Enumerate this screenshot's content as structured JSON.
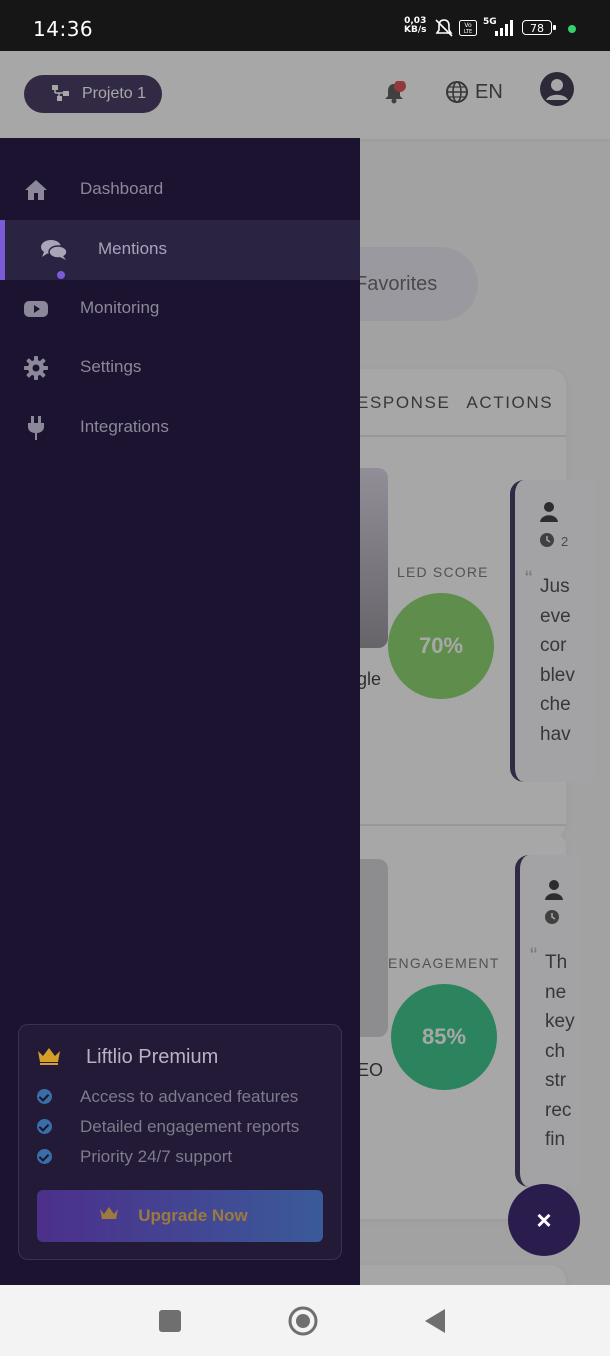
{
  "status_bar": {
    "time": "14:36",
    "net_speed_value": "0,03",
    "net_speed_unit": "KB/s",
    "network_type": "5G",
    "battery": "78"
  },
  "header": {
    "project_label": "Projeto 1",
    "language": "EN"
  },
  "background": {
    "favorites_tab": "Favorites",
    "column_headers": [
      "ESPONSE",
      "ACTIONS"
    ],
    "rows": [
      {
        "score_label": "LED SCORE",
        "score": "70%",
        "score_color": "#7dd15a",
        "title_fragment": "gle",
        "comment_date": "2",
        "comment_lines": [
          "Jus",
          "eve",
          "cor",
          "blev",
          "che",
          "hav"
        ]
      },
      {
        "score_label": "ENGAGEMENT",
        "score": "85%",
        "score_color": "#1fbf7a",
        "title_fragment": "EO",
        "comment_lines": [
          "Th",
          "ne",
          "key",
          "ch",
          "str",
          "rec",
          "fin"
        ]
      }
    ]
  },
  "drawer": {
    "items": [
      {
        "label": "Dashboard",
        "icon": "home-icon",
        "active": false
      },
      {
        "label": "Mentions",
        "icon": "comments-icon",
        "active": true
      },
      {
        "label": "Monitoring",
        "icon": "youtube-icon",
        "active": false
      },
      {
        "label": "Settings",
        "icon": "gear-icon",
        "active": false
      },
      {
        "label": "Integrations",
        "icon": "plug-icon",
        "active": false
      }
    ],
    "premium": {
      "title": "Liftlio Premium",
      "features": [
        "Access to advanced features",
        "Detailed engagement reports",
        "Priority 24/7 support"
      ],
      "button_label": "Upgrade Now"
    }
  },
  "fab_label": "×",
  "colors": {
    "drawer_bg": "#1b1330",
    "accent": "#7b5cd6",
    "primary_dark": "#2a1d4d"
  }
}
